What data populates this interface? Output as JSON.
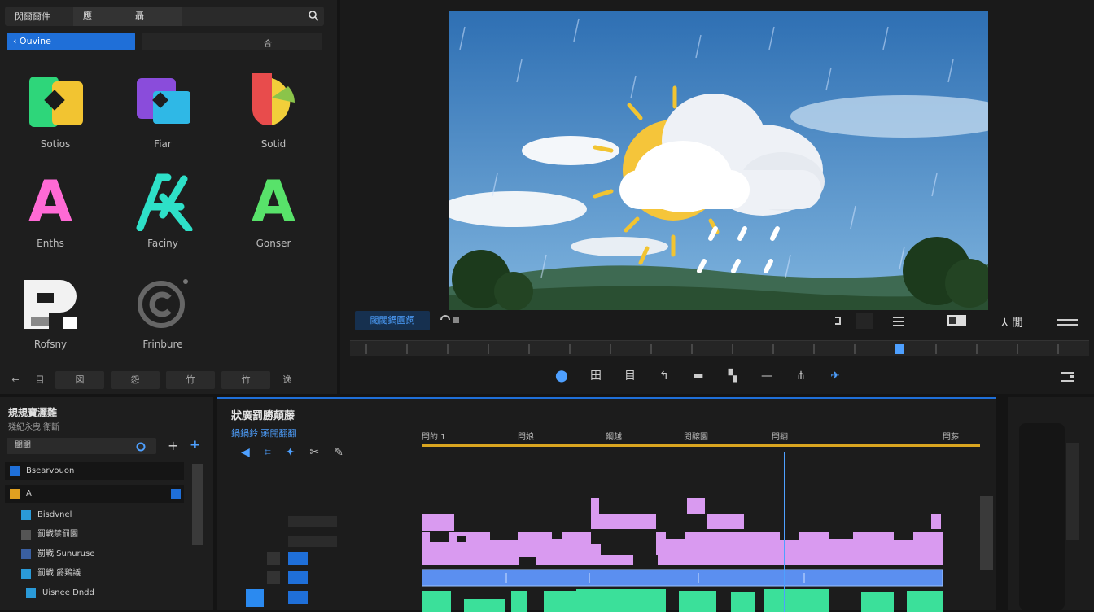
{
  "library": {
    "tabs": [
      "閃爾爾件",
      "應",
      "聶"
    ],
    "sub_active": "Ouvine",
    "sub_right": "合",
    "tiles": [
      {
        "label": "Sotios",
        "icon": "shape-icon-green-yellow"
      },
      {
        "label": "Fiar",
        "icon": "shape-icon-purple-blue"
      },
      {
        "label": "Sotid",
        "icon": "shape-icon-red-yellow"
      },
      {
        "label": "Enths",
        "letter": "A",
        "color": "#ff6ad5"
      },
      {
        "label": "Faciny",
        "letter": "X",
        "color": "#2ee0c8"
      },
      {
        "label": "Gonser",
        "letter": "A",
        "color": "#58e26a"
      },
      {
        "label": "Rofsny",
        "icon": "block-letter-icon"
      },
      {
        "label": "Frinbure",
        "icon": "copyright-icon"
      }
    ],
    "bottom": [
      "←",
      "目",
      "図",
      "怨",
      "竹",
      "竹",
      "逸"
    ]
  },
  "preview": {
    "timecode": "閾閥鍋園飼",
    "right_label": "閒",
    "tools": [
      "⬤",
      "田",
      "目",
      "↰",
      "▬",
      "▚",
      "—",
      "⋔",
      "✈"
    ]
  },
  "project": {
    "title": "規規寶灑難",
    "subtitle": "殘紀永曳 衛斷",
    "search": "閾閾",
    "rows": [
      {
        "label": "Bsearvouon",
        "color": "#1f6fd8"
      },
      {
        "label": "A",
        "color": "#e0a020"
      },
      {
        "label": "Bisdvnel",
        "color": "#2a9ad8"
      },
      {
        "label": "罰戦禁罰園",
        "color": "#555"
      },
      {
        "label": "罰戦 Sunuruse",
        "color": "#3a5fa0"
      },
      {
        "label": "罰戦 爵鶏議",
        "color": "#2a9ad8"
      },
      {
        "label": "Uisnee Dndd",
        "color": "#2a9ad8"
      }
    ]
  },
  "timeline": {
    "title": "狀廣罰勝顛藤",
    "subtitle": "鍋鍋鈴 頭開翻翻",
    "ticks": [
      "閂的 1",
      "閂娘",
      "鋼越",
      "閱醸園",
      "閂翻",
      "閂藤"
    ]
  },
  "colors": {
    "accent": "#1f6fd8",
    "pink": "#d99af0",
    "green": "#3be09a"
  }
}
